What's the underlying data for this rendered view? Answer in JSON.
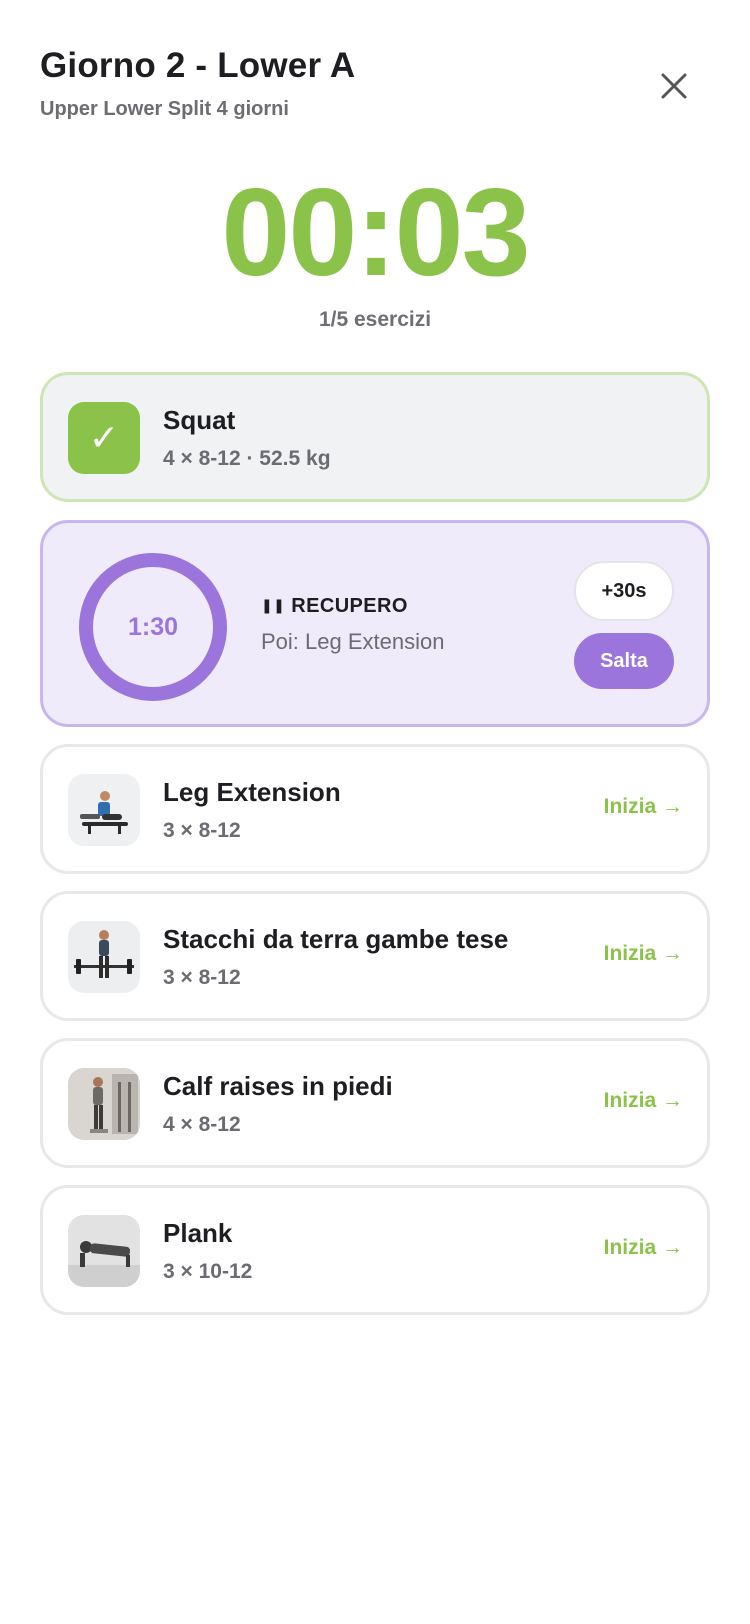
{
  "header": {
    "title": "Giorno 2 - Lower A",
    "subtitle": "Upper Lower Split 4 giorni",
    "close_icon": "close-icon"
  },
  "timer": {
    "elapsed": "00:03",
    "progress": "1/5 esercizi"
  },
  "colors": {
    "accent_green": "#8bc34a",
    "accent_purple": "#9b74dc"
  },
  "completed_exercise": {
    "name": "Squat",
    "detail": "4 × 8-12 · 52.5 kg",
    "icon": "check-icon",
    "check_glyph": "✓"
  },
  "rest": {
    "countdown": "1:30",
    "label": "RECUPERO",
    "pause_glyph": "❚❚",
    "next": "Poi: Leg Extension",
    "add_label": "+30s",
    "skip_label": "Salta"
  },
  "exercises": [
    {
      "name": "Leg Extension",
      "detail": "3 × 8-12",
      "action": "Inizia →"
    },
    {
      "name": "Stacchi da terra gambe tese",
      "detail": "3 × 8-12",
      "action": "Inizia →"
    },
    {
      "name": "Calf raises in piedi",
      "detail": "4 × 8-12",
      "action": "Inizia →"
    },
    {
      "name": "Plank",
      "detail": "3 × 10-12",
      "action": "Inizia →"
    }
  ]
}
